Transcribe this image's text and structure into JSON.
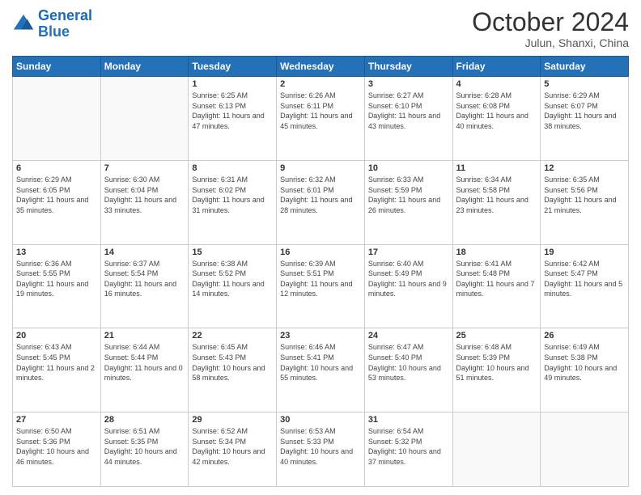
{
  "header": {
    "logo_line1": "General",
    "logo_line2": "Blue",
    "title": "October 2024",
    "subtitle": "Julun, Shanxi, China"
  },
  "days": [
    "Sunday",
    "Monday",
    "Tuesday",
    "Wednesday",
    "Thursday",
    "Friday",
    "Saturday"
  ],
  "weeks": [
    [
      {
        "date": "",
        "sunrise": "",
        "sunset": "",
        "daylight": ""
      },
      {
        "date": "",
        "sunrise": "",
        "sunset": "",
        "daylight": ""
      },
      {
        "date": "1",
        "sunrise": "Sunrise: 6:25 AM",
        "sunset": "Sunset: 6:13 PM",
        "daylight": "Daylight: 11 hours and 47 minutes."
      },
      {
        "date": "2",
        "sunrise": "Sunrise: 6:26 AM",
        "sunset": "Sunset: 6:11 PM",
        "daylight": "Daylight: 11 hours and 45 minutes."
      },
      {
        "date": "3",
        "sunrise": "Sunrise: 6:27 AM",
        "sunset": "Sunset: 6:10 PM",
        "daylight": "Daylight: 11 hours and 43 minutes."
      },
      {
        "date": "4",
        "sunrise": "Sunrise: 6:28 AM",
        "sunset": "Sunset: 6:08 PM",
        "daylight": "Daylight: 11 hours and 40 minutes."
      },
      {
        "date": "5",
        "sunrise": "Sunrise: 6:29 AM",
        "sunset": "Sunset: 6:07 PM",
        "daylight": "Daylight: 11 hours and 38 minutes."
      }
    ],
    [
      {
        "date": "6",
        "sunrise": "Sunrise: 6:29 AM",
        "sunset": "Sunset: 6:05 PM",
        "daylight": "Daylight: 11 hours and 35 minutes."
      },
      {
        "date": "7",
        "sunrise": "Sunrise: 6:30 AM",
        "sunset": "Sunset: 6:04 PM",
        "daylight": "Daylight: 11 hours and 33 minutes."
      },
      {
        "date": "8",
        "sunrise": "Sunrise: 6:31 AM",
        "sunset": "Sunset: 6:02 PM",
        "daylight": "Daylight: 11 hours and 31 minutes."
      },
      {
        "date": "9",
        "sunrise": "Sunrise: 6:32 AM",
        "sunset": "Sunset: 6:01 PM",
        "daylight": "Daylight: 11 hours and 28 minutes."
      },
      {
        "date": "10",
        "sunrise": "Sunrise: 6:33 AM",
        "sunset": "Sunset: 5:59 PM",
        "daylight": "Daylight: 11 hours and 26 minutes."
      },
      {
        "date": "11",
        "sunrise": "Sunrise: 6:34 AM",
        "sunset": "Sunset: 5:58 PM",
        "daylight": "Daylight: 11 hours and 23 minutes."
      },
      {
        "date": "12",
        "sunrise": "Sunrise: 6:35 AM",
        "sunset": "Sunset: 5:56 PM",
        "daylight": "Daylight: 11 hours and 21 minutes."
      }
    ],
    [
      {
        "date": "13",
        "sunrise": "Sunrise: 6:36 AM",
        "sunset": "Sunset: 5:55 PM",
        "daylight": "Daylight: 11 hours and 19 minutes."
      },
      {
        "date": "14",
        "sunrise": "Sunrise: 6:37 AM",
        "sunset": "Sunset: 5:54 PM",
        "daylight": "Daylight: 11 hours and 16 minutes."
      },
      {
        "date": "15",
        "sunrise": "Sunrise: 6:38 AM",
        "sunset": "Sunset: 5:52 PM",
        "daylight": "Daylight: 11 hours and 14 minutes."
      },
      {
        "date": "16",
        "sunrise": "Sunrise: 6:39 AM",
        "sunset": "Sunset: 5:51 PM",
        "daylight": "Daylight: 11 hours and 12 minutes."
      },
      {
        "date": "17",
        "sunrise": "Sunrise: 6:40 AM",
        "sunset": "Sunset: 5:49 PM",
        "daylight": "Daylight: 11 hours and 9 minutes."
      },
      {
        "date": "18",
        "sunrise": "Sunrise: 6:41 AM",
        "sunset": "Sunset: 5:48 PM",
        "daylight": "Daylight: 11 hours and 7 minutes."
      },
      {
        "date": "19",
        "sunrise": "Sunrise: 6:42 AM",
        "sunset": "Sunset: 5:47 PM",
        "daylight": "Daylight: 11 hours and 5 minutes."
      }
    ],
    [
      {
        "date": "20",
        "sunrise": "Sunrise: 6:43 AM",
        "sunset": "Sunset: 5:45 PM",
        "daylight": "Daylight: 11 hours and 2 minutes."
      },
      {
        "date": "21",
        "sunrise": "Sunrise: 6:44 AM",
        "sunset": "Sunset: 5:44 PM",
        "daylight": "Daylight: 11 hours and 0 minutes."
      },
      {
        "date": "22",
        "sunrise": "Sunrise: 6:45 AM",
        "sunset": "Sunset: 5:43 PM",
        "daylight": "Daylight: 10 hours and 58 minutes."
      },
      {
        "date": "23",
        "sunrise": "Sunrise: 6:46 AM",
        "sunset": "Sunset: 5:41 PM",
        "daylight": "Daylight: 10 hours and 55 minutes."
      },
      {
        "date": "24",
        "sunrise": "Sunrise: 6:47 AM",
        "sunset": "Sunset: 5:40 PM",
        "daylight": "Daylight: 10 hours and 53 minutes."
      },
      {
        "date": "25",
        "sunrise": "Sunrise: 6:48 AM",
        "sunset": "Sunset: 5:39 PM",
        "daylight": "Daylight: 10 hours and 51 minutes."
      },
      {
        "date": "26",
        "sunrise": "Sunrise: 6:49 AM",
        "sunset": "Sunset: 5:38 PM",
        "daylight": "Daylight: 10 hours and 49 minutes."
      }
    ],
    [
      {
        "date": "27",
        "sunrise": "Sunrise: 6:50 AM",
        "sunset": "Sunset: 5:36 PM",
        "daylight": "Daylight: 10 hours and 46 minutes."
      },
      {
        "date": "28",
        "sunrise": "Sunrise: 6:51 AM",
        "sunset": "Sunset: 5:35 PM",
        "daylight": "Daylight: 10 hours and 44 minutes."
      },
      {
        "date": "29",
        "sunrise": "Sunrise: 6:52 AM",
        "sunset": "Sunset: 5:34 PM",
        "daylight": "Daylight: 10 hours and 42 minutes."
      },
      {
        "date": "30",
        "sunrise": "Sunrise: 6:53 AM",
        "sunset": "Sunset: 5:33 PM",
        "daylight": "Daylight: 10 hours and 40 minutes."
      },
      {
        "date": "31",
        "sunrise": "Sunrise: 6:54 AM",
        "sunset": "Sunset: 5:32 PM",
        "daylight": "Daylight: 10 hours and 37 minutes."
      },
      {
        "date": "",
        "sunrise": "",
        "sunset": "",
        "daylight": ""
      },
      {
        "date": "",
        "sunrise": "",
        "sunset": "",
        "daylight": ""
      }
    ]
  ]
}
